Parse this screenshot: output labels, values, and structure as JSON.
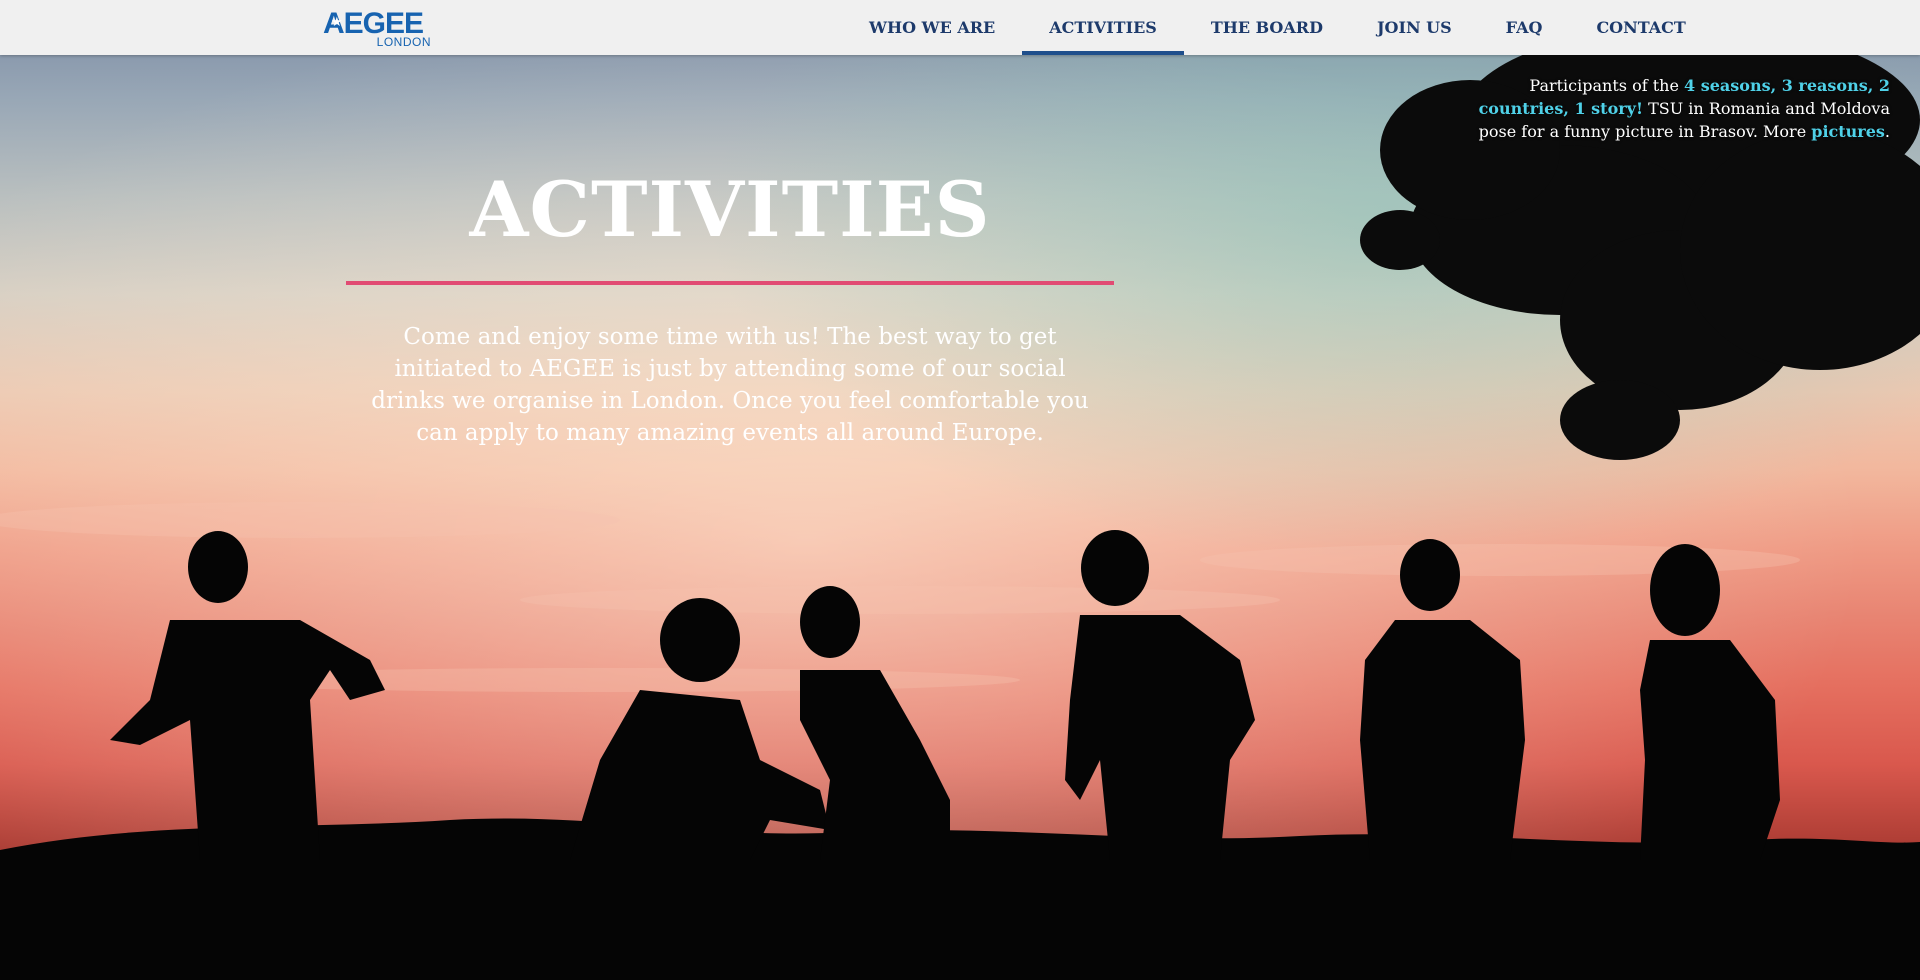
{
  "nav": {
    "logo_word": "AEGEE",
    "logo_sub": "LONDON",
    "items": [
      {
        "label": "WHO WE ARE"
      },
      {
        "label": "ACTIVITIES",
        "active": true
      },
      {
        "label": "THE BOARD"
      },
      {
        "label": "JOIN US"
      },
      {
        "label": "FAQ"
      },
      {
        "label": "CONTACT"
      }
    ]
  },
  "hero": {
    "title": "ACTIVITIES",
    "description": "Come and enjoy some time with us! The best way to get initiated to AEGEE is just by attending some of our social drinks we organise in London. Once you feel comfortable you can apply to many amazing events all around Europe."
  },
  "caption": {
    "prefix": "Participants of the ",
    "event_link": "4 seasons, 3 reasons, 2 countries, 1 story!",
    "middle": " TSU in Romania and Moldova pose for a funny picture in Brasov. More ",
    "pictures_link": "pictures",
    "suffix": "."
  },
  "colors": {
    "nav_background": "#f0f0f0",
    "nav_text": "#1d3a6b",
    "logo_blue": "#1763b0",
    "accent_rule": "#e14b73",
    "caption_link": "#4fd1e8"
  }
}
